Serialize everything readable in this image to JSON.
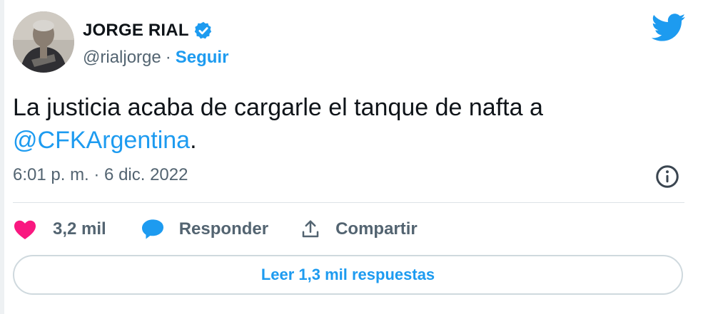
{
  "author": {
    "name": "JORGE RIAL",
    "handle": "@rialjorge",
    "separator": "·",
    "follow_label": "Seguir",
    "verified": true
  },
  "tweet": {
    "text_before": "La justicia acaba de cargarle el tanque de nafta a",
    "mention": "@CFKArgentina",
    "text_after": ".",
    "timestamp": "6:01 p. m. · 6 dic. 2022"
  },
  "actions": {
    "likes": "3,2 mil",
    "reply_label": "Responder",
    "share_label": "Compartir"
  },
  "replies_button": "Leer 1,3 mil respuestas",
  "icons": {
    "brand": "twitter-bird-icon",
    "verified": "verified-badge-icon",
    "info": "info-icon",
    "like": "heart-icon",
    "reply": "reply-bubble-icon",
    "share": "share-icon"
  },
  "colors": {
    "accent": "#1d9bf0",
    "like": "#f91880",
    "text": "#0f1419",
    "secondary": "#536471"
  }
}
